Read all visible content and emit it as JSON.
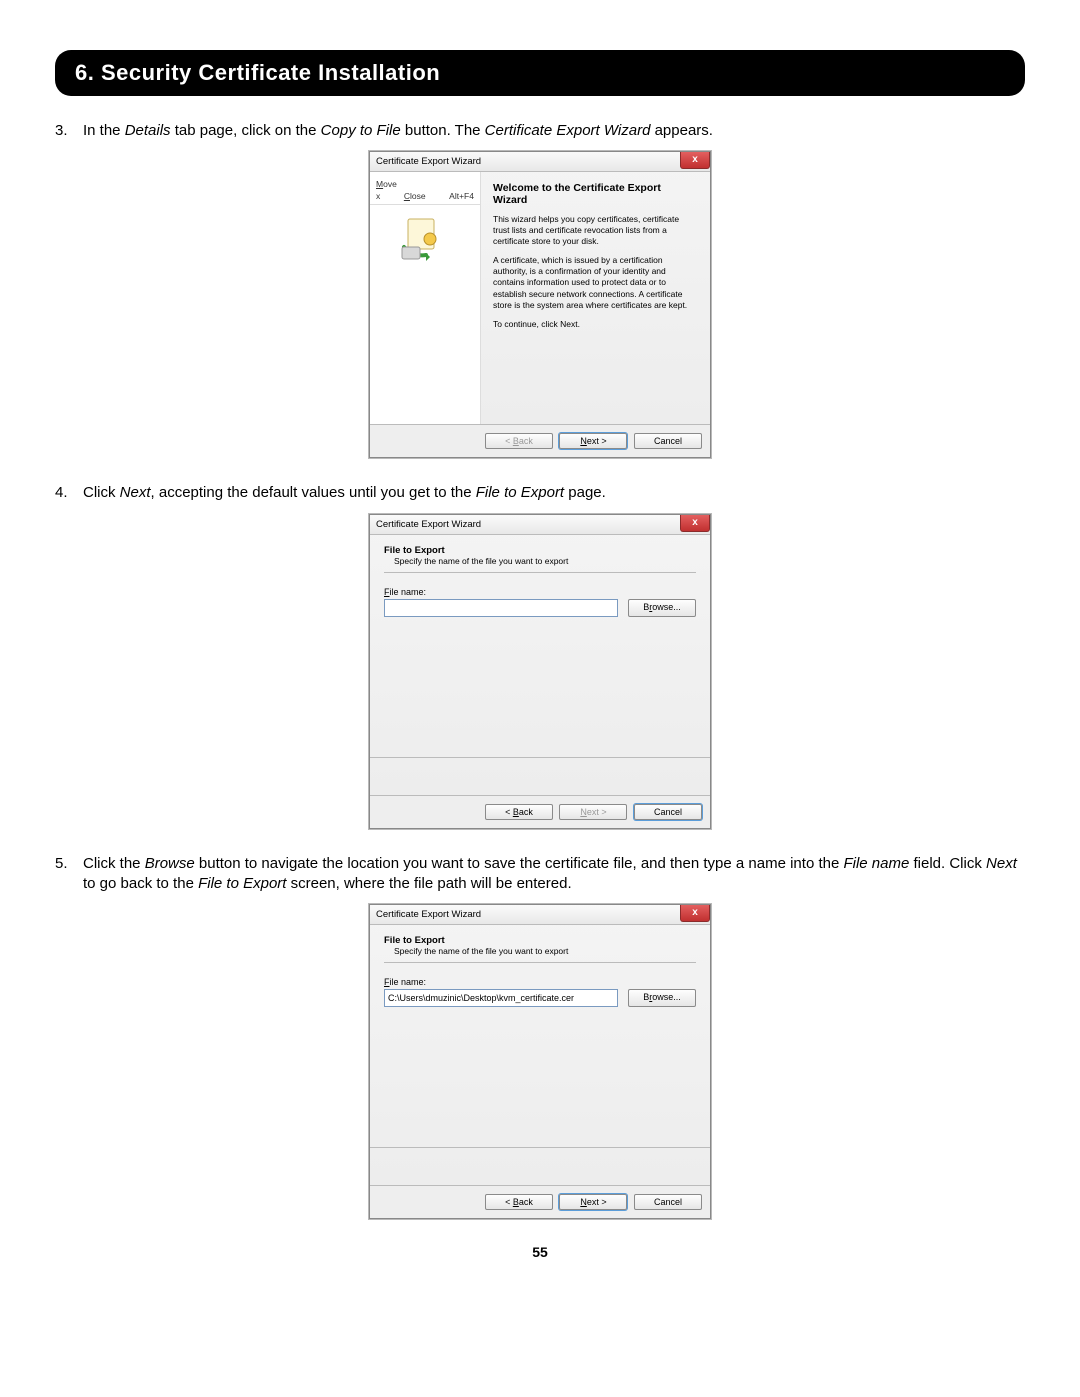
{
  "header": "6. Security Certificate Installation",
  "page_number": "55",
  "steps": {
    "s3": {
      "num": "3.",
      "pre": "In the ",
      "i1": "Details",
      "mid1": " tab page, click on the ",
      "i2": "Copy to File",
      "mid2": " button. The ",
      "i3": "Certificate Export Wizard",
      "post": " appears."
    },
    "s4": {
      "num": "4.",
      "pre": "Click ",
      "i1": "Next",
      "mid1": ", accepting the default values until you get to the ",
      "i2": "File to Export",
      "post": " page."
    },
    "s5": {
      "num": "5.",
      "pre": "Click the ",
      "i1": "Browse",
      "mid1": " button to navigate the location you want to save the certificate file, and then type a name into the ",
      "i2": "File name",
      "mid2": " field. Click ",
      "i3": "Next",
      "mid3": " to go back to the ",
      "i4": "File to Export",
      "post": " screen, where the file path will be entered."
    }
  },
  "wiz_common": {
    "title": "Certificate Export Wizard",
    "close_glyph": "x",
    "back": "< Back",
    "next": "Next >",
    "cancel": "Cancel",
    "browse": "Browse...",
    "file_to_export": "File to Export",
    "specify": "Specify the name of the file you want to export",
    "file_name_label": "File name:"
  },
  "wiz1": {
    "menu_move": "Move",
    "menu_close": "Close",
    "menu_alt": "Alt+F4",
    "menu_x": "x",
    "heading": "Welcome to the Certificate Export Wizard",
    "p1": "This wizard helps you copy certificates, certificate trust lists and certificate revocation lists from a certificate store to your disk.",
    "p2": "A certificate, which is issued by a certification authority, is a confirmation of your identity and contains information used to protect data or to establish secure network connections. A certificate store is the system area where certificates are kept.",
    "p3": "To continue, click Next."
  },
  "wiz2": {
    "file_value": ""
  },
  "wiz3": {
    "file_value": "C:\\Users\\dmuzinic\\Desktop\\kvm_certificate.cer"
  }
}
